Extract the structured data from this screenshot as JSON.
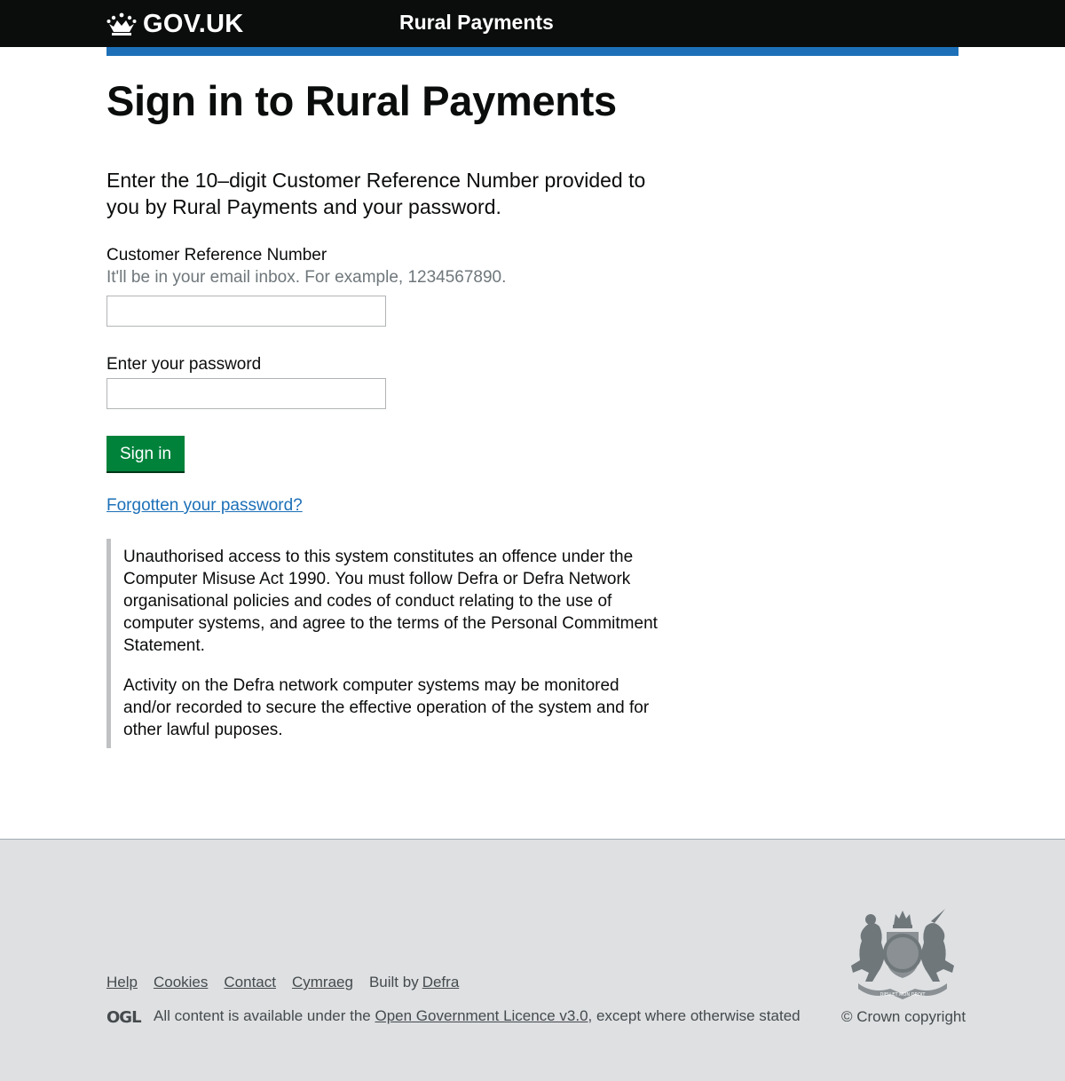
{
  "header": {
    "logo_text": "GOV.UK",
    "service_name": "Rural Payments"
  },
  "main": {
    "heading": "Sign in to Rural Payments",
    "lead": "Enter the 10–digit Customer Reference Number provided to you by Rural Payments and your password.",
    "crn_field": {
      "label": "Customer Reference Number",
      "hint": "It'll be in your email inbox. For example, 1234567890.",
      "value": ""
    },
    "password_field": {
      "label": "Enter your password",
      "value": ""
    },
    "sign_in_button": "Sign in",
    "forgotten_link": "Forgotten your password?",
    "notice": [
      "Unauthorised access to this system constitutes an offence under the Computer Misuse Act 1990. You must follow Defra or Defra Network organisational policies and codes of conduct relating to the use of computer systems, and agree to the terms of the Personal Commitment Statement.",
      "Activity on the Defra network computer systems may be monitored and/or recorded to secure the effective operation of the system and for other lawful puposes."
    ]
  },
  "footer": {
    "links": [
      "Help",
      "Cookies",
      "Contact",
      "Cymraeg"
    ],
    "built_by_prefix": "Built by",
    "built_by_link": "Defra",
    "ogl_logo_text": "OGL",
    "licence_prefix": "All content is available under the",
    "licence_link": "Open Government Licence v3.0",
    "licence_suffix": ", except where otherwise stated",
    "copyright": "© Crown copyright",
    "crest_icon": "royal-coat-of-arms-icon",
    "crest_text": [
      "DIEU ET MON DROIT"
    ]
  },
  "colors": {
    "header_bg": "#0b0c0c",
    "header_bar": "#1d70b8",
    "button": "#00823b",
    "link": "#1d70b8",
    "footer_bg": "#dee0e2",
    "inset_border": "#bfc1c3"
  }
}
